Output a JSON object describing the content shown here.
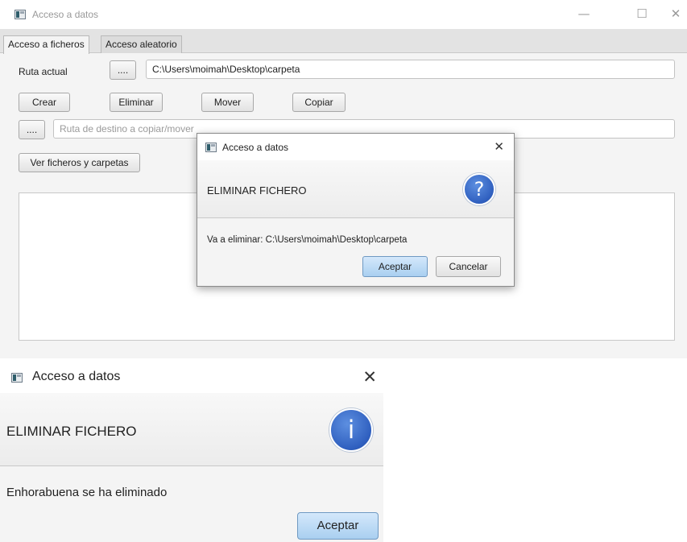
{
  "main_window": {
    "title": "Acceso a datos",
    "controls": {
      "minimize": "—",
      "maximize": "☐",
      "close": "✕"
    },
    "tabs": [
      {
        "label": "Acceso a ficheros",
        "active": true
      },
      {
        "label": "Acceso aleatorio",
        "active": false
      }
    ],
    "path_label": "Ruta actual",
    "browse_label": "....",
    "current_path": "C:\\Users\\moimah\\Desktop\\carpeta",
    "actions": {
      "create": "Crear",
      "delete": "Eliminar",
      "move": "Mover",
      "copy": "Copiar"
    },
    "dest_browse_label": "....",
    "dest_placeholder": "Ruta de destino a copiar/mover",
    "view_button": "Ver ficheros y carpetas"
  },
  "confirm_dialog": {
    "title": "Acceso a datos",
    "close": "✕",
    "header": "ELIMINAR FICHERO",
    "icon": "question-icon",
    "icon_glyph": "?",
    "message": "Va a eliminar: C:\\Users\\moimah\\Desktop\\carpeta",
    "ok_label": "Aceptar",
    "cancel_label": "Cancelar"
  },
  "info_dialog": {
    "title": "Acceso a datos",
    "close": "✕",
    "header": "ELIMINAR FICHERO",
    "icon": "info-icon",
    "icon_glyph": "i",
    "message": "Enhorabuena se ha eliminado",
    "ok_label": "Aceptar"
  },
  "colors": {
    "accent_button": "#a9cff0",
    "icon_blue": "#2f5fbf",
    "window_bg": "#f4f4f4"
  }
}
